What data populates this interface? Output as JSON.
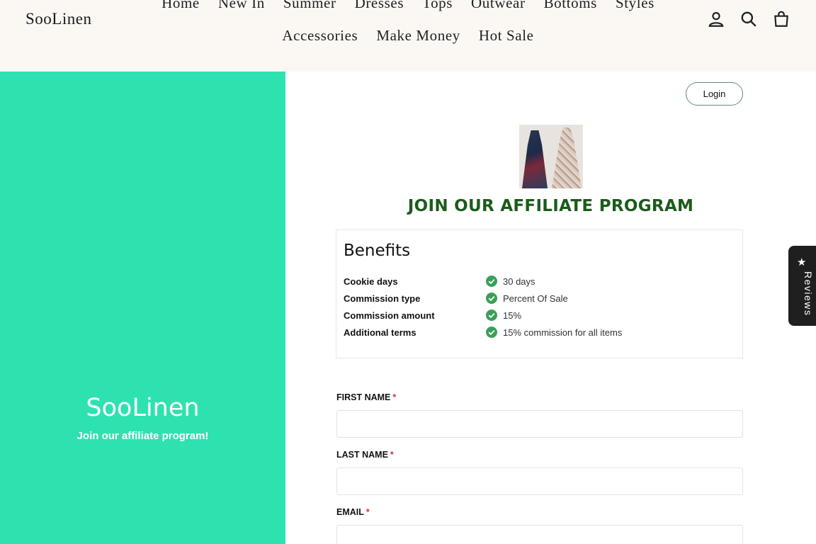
{
  "header": {
    "logo": "SooLinen",
    "nav_row1": [
      "Home",
      "New In",
      "Summer",
      "Dresses",
      "Tops",
      "Outwear",
      "Bottoms",
      "Styles"
    ],
    "nav_row2": [
      "Accessories",
      "Make Money",
      "Hot Sale"
    ],
    "icons": [
      "account-icon",
      "search-icon",
      "cart-icon"
    ]
  },
  "left_panel": {
    "title": "SooLinen",
    "subtitle": "Join our affiliate program!",
    "background": "#2ee2b0"
  },
  "main": {
    "login_label": "Login",
    "heading": "JOIN OUR AFFILIATE PROGRAM",
    "heading_color": "#1c5b1c",
    "benefits": {
      "title": "Benefits",
      "rows": [
        {
          "key": "Cookie days",
          "value": "30 days"
        },
        {
          "key": "Commission type",
          "value": "Percent Of Sale"
        },
        {
          "key": "Commission amount",
          "value": "15%"
        },
        {
          "key": "Additional terms",
          "value": "15% commission for all items"
        }
      ]
    },
    "form": {
      "first_name_label": "FIRST NAME",
      "last_name_label": "LAST NAME",
      "email_label": "EMAIL",
      "required_marker": "*",
      "first_name_value": "",
      "last_name_value": "",
      "email_value": ""
    }
  },
  "reviews_tab": {
    "label": "Reviews",
    "icon": "star-icon"
  }
}
